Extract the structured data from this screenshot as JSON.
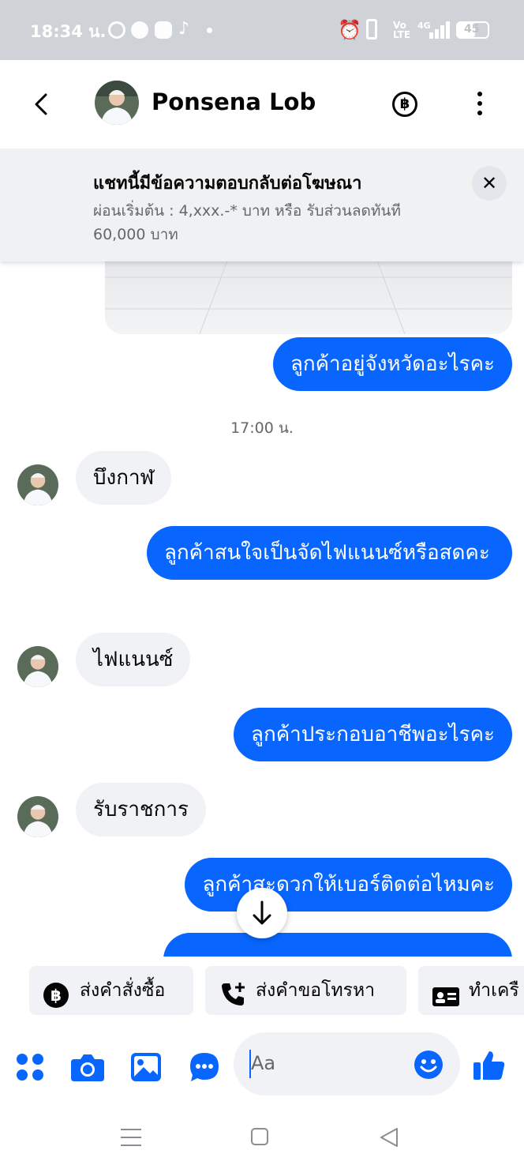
{
  "status_bar": {
    "time": "18:34 น.",
    "battery": "45",
    "network": "4G",
    "volte": "Vo LTE"
  },
  "header": {
    "contact_name": "Ponsena Lob"
  },
  "ad_banner": {
    "title": "แชทนี้มีข้อความตอบกลับต่อโฆษณา",
    "subtitle": "ผ่อนเริ่มต้น : 4,xxx.-* บาท  หรือ รับส่วนลดทันที 60,000 บาท"
  },
  "messages": [
    {
      "side": "out",
      "text": "ลูกค้าอยู่จังหวัดอะไรคะ"
    },
    {
      "side": "ts",
      "text": "17:00 น."
    },
    {
      "side": "in",
      "text": "บึงกาฬ"
    },
    {
      "side": "out",
      "text": "ลูกค้าสนใจเป็นจัดไฟแนนซ์หรือสดคะ"
    },
    {
      "side": "in",
      "text": "ไฟแนนซ์"
    },
    {
      "side": "out",
      "text": "ลูกค้าประกอบอาชีพอะไรคะ"
    },
    {
      "side": "in",
      "text": "รับราชการ"
    },
    {
      "side": "out",
      "text": "ลูกค้าสะดวกให้เบอร์ติดต่อไหมคะ"
    }
  ],
  "quick_replies": [
    {
      "label": "ส่งคำสั่งซื้อ",
      "icon": "baht-icon"
    },
    {
      "label": "ส่งคำขอโทรหา",
      "icon": "phone-add-icon"
    },
    {
      "label": "ทำเครื",
      "icon": "id-card-icon"
    }
  ],
  "composer": {
    "placeholder": "Aa"
  },
  "colors": {
    "accent": "#0866ff",
    "incoming_bubble": "#f0f2f5",
    "status_bar": "#cfd2d6"
  }
}
